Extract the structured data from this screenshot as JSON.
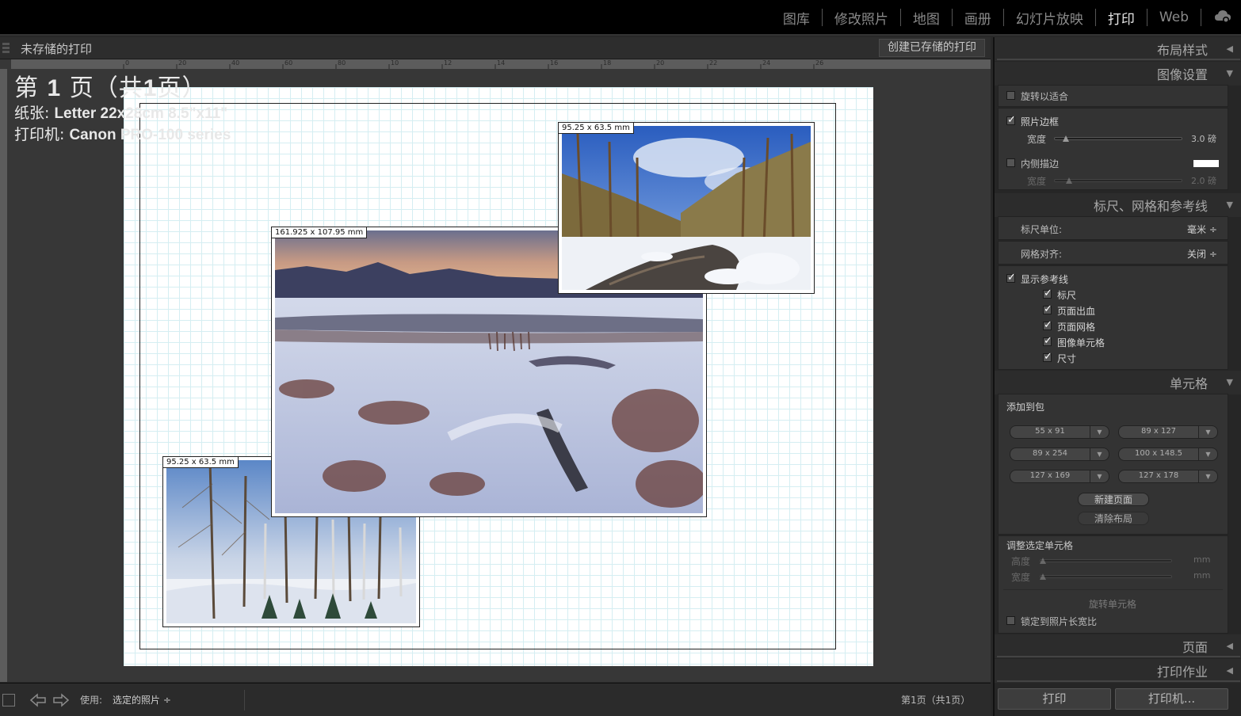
{
  "modules": [
    {
      "label": "图库",
      "active": false
    },
    {
      "label": "修改照片",
      "active": false
    },
    {
      "label": "地图",
      "active": false
    },
    {
      "label": "画册",
      "active": false
    },
    {
      "label": "幻灯片放映",
      "active": false
    },
    {
      "label": "打印",
      "active": true
    },
    {
      "label": "Web",
      "active": false
    }
  ],
  "header": {
    "title": "未存储的打印",
    "save_button": "创建已存储的打印"
  },
  "ruler_top": [
    "0",
    "20",
    "40",
    "60",
    "80",
    "10",
    "12",
    "14",
    "16",
    "18",
    "20",
    "22",
    "24",
    "26"
  ],
  "page_info": {
    "page_label": "第",
    "page_num": "1",
    "page_suffix": "页（共",
    "page_total": "1",
    "page_end": "页）",
    "paper_label": "纸张:",
    "paper_value": "Letter 22x28cm 8.5\"x11\"",
    "printer_label": "打印机:",
    "printer_value": "Canon PRO-100 series"
  },
  "cells": [
    {
      "dimension": "95.25 x 63.5 mm",
      "photo": "winter-forest-river"
    },
    {
      "dimension": "161.925 x 107.95 mm",
      "photo": "snowy-valley-sunset"
    },
    {
      "dimension": "95.25 x 63.5 mm",
      "photo": "birch-forest-snow"
    }
  ],
  "bottom_bar": {
    "use_label": "使用:",
    "use_value": "选定的照片 ÷",
    "page_status": "第1页（共1页）"
  },
  "panel": {
    "layout_style": "布局样式",
    "image_settings": "图像设置",
    "rotate_to_fit": "旋转以适合",
    "photo_border": "照片边框",
    "width_label": "宽度",
    "border_width_value": "3.0 磅",
    "inner_stroke": "内侧描边",
    "stroke_width_value": "2.0 磅",
    "stroke_color": "#ffffff",
    "rulers_section": "标尺、网格和参考线",
    "ruler_units_label": "标尺单位:",
    "ruler_units_value": "毫米 ÷",
    "grid_snap_label": "网格对齐:",
    "grid_snap_value": "关闭 ÷",
    "show_guides": "显示参考线",
    "guides": [
      "标尺",
      "页面出血",
      "页面网格",
      "图像单元格",
      "尺寸"
    ],
    "cells_section": "单元格",
    "add_to_package": "添加到包",
    "sizes": [
      "55 x 91",
      "89 x 127",
      "89 x 254",
      "100 x 148.5",
      "127 x 169",
      "127 x 178"
    ],
    "new_page": "新建页面",
    "clear_layout": "清除布局",
    "adjust_cell": "调整选定单元格",
    "height_label": "高度",
    "width_label2": "宽度",
    "unit_mm": "mm",
    "rotate_cell": "旋转单元格",
    "lock_aspect": "锁定到照片长宽比",
    "page_section": "页面",
    "print_job": "打印作业",
    "print_button": "打印",
    "printer_button": "打印机..."
  },
  "colors": {
    "accent_active": "#e6e6e6",
    "paper": "#ffffff",
    "grid": "#d5eef2"
  }
}
